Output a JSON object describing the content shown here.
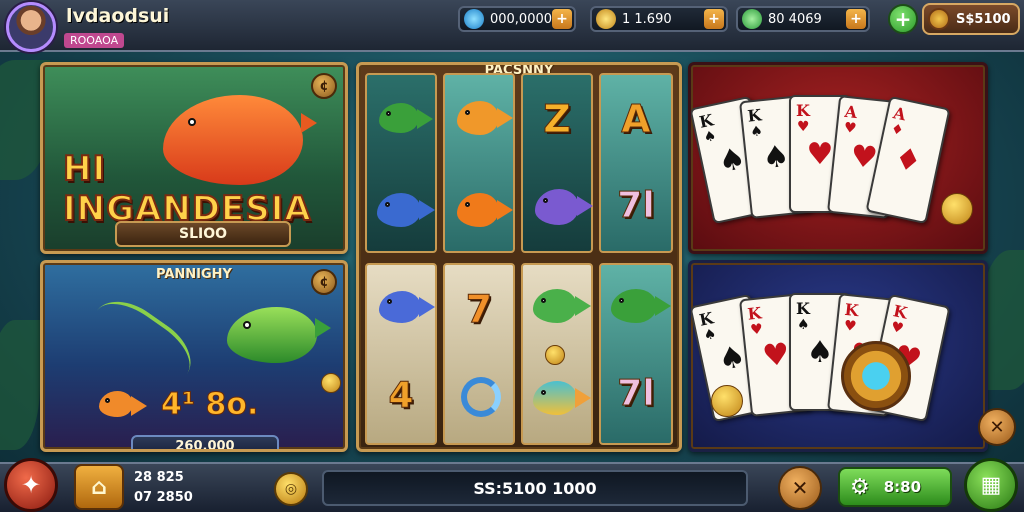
{
  "header": {
    "player_name": "lvdaodsui",
    "player_badge": "ROOAOA",
    "currencies": [
      {
        "icon": "gem-icon",
        "value": "000,0000",
        "color": "#3aa8e8"
      },
      {
        "icon": "gold-coin-icon",
        "value": "1 1.690",
        "color": "#e8c23a"
      },
      {
        "icon": "green-coin-icon",
        "value": "80 4069",
        "color": "#3ac26a"
      }
    ],
    "add_label": "+",
    "balance": "S$5100"
  },
  "panels": {
    "fish_hunt": {
      "title": "HI INGANDESIA",
      "value": "SLIOO",
      "corner": "¢"
    },
    "fishing": {
      "title": "PANNIGHY",
      "value": "260,000",
      "corner": "¢",
      "bonus_text": "4¹ 8o."
    },
    "slots": {
      "title": "PACSNNY"
    },
    "cards_top": {},
    "cards_bottom": {}
  },
  "slot_symbols": {
    "top": [
      "Z",
      "A",
      "7l"
    ],
    "bottom": [
      "7",
      "4",
      "7l"
    ]
  },
  "cards_top": [
    {
      "rank": "K",
      "suit": "♠",
      "color": "#111"
    },
    {
      "rank": "K",
      "suit": "♠",
      "color": "#111"
    },
    {
      "rank": "K",
      "suit": "♥",
      "color": "#c2121c"
    },
    {
      "rank": "A",
      "suit": "♥",
      "color": "#c2121c"
    },
    {
      "rank": "A",
      "suit": "♦",
      "color": "#c2121c"
    }
  ],
  "cards_bottom": [
    {
      "rank": "K",
      "suit": "♠",
      "color": "#111"
    },
    {
      "rank": "K",
      "suit": "♥",
      "color": "#c2121c"
    },
    {
      "rank": "K",
      "suit": "♠",
      "color": "#111"
    },
    {
      "rank": "K",
      "suit": "♥",
      "color": "#c2121c"
    },
    {
      "rank": "K",
      "suit": "♥",
      "color": "#c2121c"
    }
  ],
  "footer": {
    "stat_top": "28 825",
    "stat_bottom": "07 2850",
    "bet_display": "SS:5100 1000",
    "confirm_value": "8:80",
    "close_label": "✕"
  }
}
